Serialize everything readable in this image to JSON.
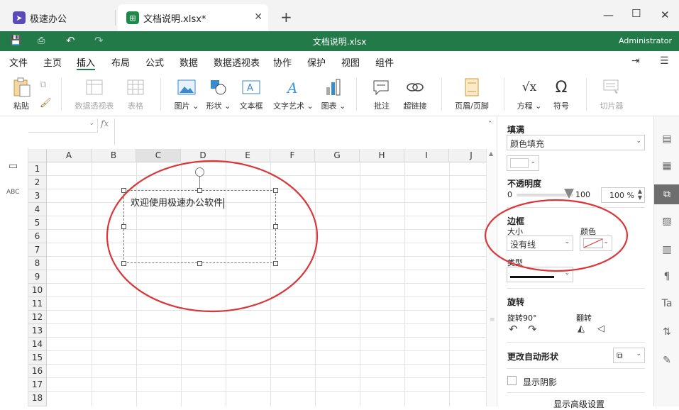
{
  "tabs": [
    {
      "label": "极速办公"
    },
    {
      "label": "文档说明.xlsx*"
    }
  ],
  "appbar": {
    "title": "文档说明.xlsx",
    "user": "Administrator"
  },
  "menu": [
    "文件",
    "主页",
    "插入",
    "布局",
    "公式",
    "数据",
    "数据透视表",
    "协作",
    "保护",
    "视图",
    "组件"
  ],
  "menu_active": "插入",
  "ribbon": {
    "paste": "粘贴",
    "pivot": "数据透视表",
    "table": "表格",
    "image": "图片",
    "shape": "形状",
    "textbox": "文本框",
    "wordart": "文字艺术",
    "chart": "图表",
    "comment": "批注",
    "hyperlink": "超链接",
    "headerfooter": "页眉/页脚",
    "equation": "方程",
    "symbol": "符号",
    "slicer": "切片器"
  },
  "formula": {
    "fx": "fx"
  },
  "columns": [
    "A",
    "B",
    "C",
    "D",
    "E",
    "F",
    "G",
    "H",
    "I",
    "J"
  ],
  "rows": [
    "1",
    "2",
    "3",
    "4",
    "5",
    "6",
    "7",
    "8",
    "9",
    "10",
    "11",
    "12",
    "13",
    "14",
    "15",
    "16",
    "17",
    "18"
  ],
  "textbox": {
    "text": "欢迎使用极速办公软件"
  },
  "panel": {
    "fill_title": "填满",
    "fill_type": "颜色填充",
    "opacity_title": "不透明度",
    "opacity_min": "0",
    "opacity_max": "100",
    "opacity_value": "100 %",
    "border_title": "边框",
    "size_label": "大小",
    "size_value": "没有线",
    "color_label": "颜色",
    "type_label": "类型",
    "rotate_title": "旋转",
    "rotate90": "旋转90°",
    "flip": "翻转",
    "change_shape": "更改自动形状",
    "show_shadow": "显示阴影",
    "advanced": "显示高级设置"
  },
  "colors": {
    "brand": "#217a47",
    "annotation": "#d9373a"
  }
}
